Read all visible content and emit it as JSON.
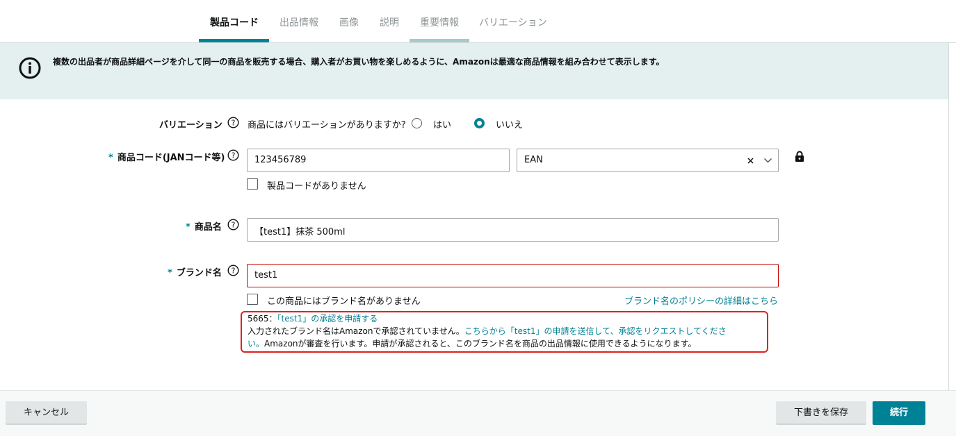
{
  "tabs": [
    {
      "label": "製品コード",
      "active": true
    },
    {
      "label": "出品情報"
    },
    {
      "label": "画像"
    },
    {
      "label": "説明"
    },
    {
      "label": "重要情報"
    },
    {
      "label": "バリエーション"
    }
  ],
  "banner": {
    "icon": "info-icon",
    "text": "複数の出品者が商品詳細ページを介して同一の商品を販売する場合、購入者がお買い物を楽しめるように、Amazonは最適な商品情報を組み合わせて表示します。"
  },
  "variation": {
    "label": "バリエーション",
    "question": "商品にはバリエーションがありますか?",
    "options": [
      "はい",
      "いいえ"
    ],
    "selected": "いいえ"
  },
  "product_code": {
    "required_mark": "*",
    "label": "商品コード(JANコード等)",
    "value": "123456789",
    "type_value": "EAN",
    "no_code_label": "製品コードがありません"
  },
  "product_name": {
    "required_mark": "*",
    "label": "商品名",
    "value": "【test1】抹茶 500ml"
  },
  "brand": {
    "required_mark": "*",
    "label": "ブランド名",
    "value": "test1",
    "no_brand_label": "この商品にはブランド名がありません",
    "policy_link": "ブランド名のポリシーの詳細はこちら"
  },
  "error": {
    "code": "5665：",
    "title_link": "「test1」の承認を申請する",
    "line1_prefix": "入力されたブランド名はAmazonで承認されていません。",
    "line1_link": "こちらから「test1」の申請を送信して、承認をリクエストしてくださ",
    "line2_link": "い。",
    "line2_rest": "Amazonが審査を行います。申請が承認されると、このブランド名を商品の出品情報に使用できるようになります。"
  },
  "footer": {
    "cancel": "キャンセル",
    "save_draft": "下書きを保存",
    "continue": "続行"
  },
  "colors": {
    "accent": "#008296",
    "error": "#c40000",
    "banner_bg": "#e4efef"
  }
}
